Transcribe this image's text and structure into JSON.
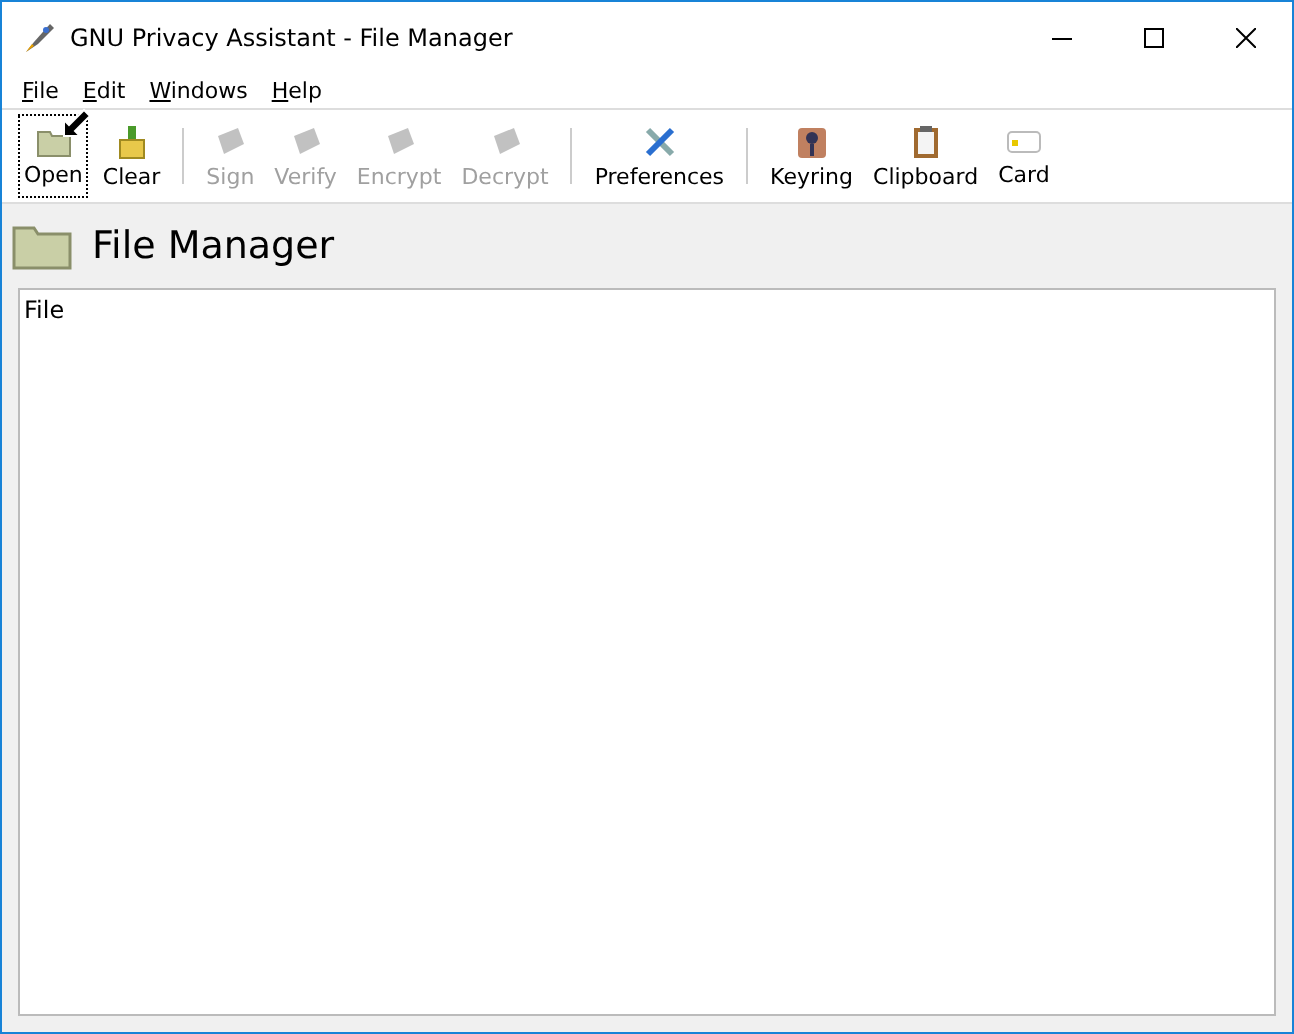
{
  "window": {
    "title": "GNU Privacy Assistant - File Manager"
  },
  "menu": [
    {
      "label": "File"
    },
    {
      "label": "Edit"
    },
    {
      "label": "Windows"
    },
    {
      "label": "Help"
    }
  ],
  "toolbar": [
    {
      "kind": "button",
      "label": "Open",
      "disabled": false,
      "focused": true
    },
    {
      "kind": "button",
      "label": "Clear",
      "disabled": false,
      "focused": false
    },
    {
      "kind": "separator"
    },
    {
      "kind": "button",
      "label": "Sign",
      "disabled": true,
      "focused": false
    },
    {
      "kind": "button",
      "label": "Verify",
      "disabled": true,
      "focused": false
    },
    {
      "kind": "button",
      "label": "Encrypt",
      "disabled": true,
      "focused": false
    },
    {
      "kind": "button",
      "label": "Decrypt",
      "disabled": true,
      "focused": false
    },
    {
      "kind": "separator"
    },
    {
      "kind": "button",
      "label": "Preferences",
      "disabled": false,
      "focused": false
    },
    {
      "kind": "separator"
    },
    {
      "kind": "button",
      "label": "Keyring",
      "disabled": false,
      "focused": false
    },
    {
      "kind": "button",
      "label": "Clipboard",
      "disabled": false,
      "focused": false
    },
    {
      "kind": "button",
      "label": "Card",
      "disabled": false,
      "focused": false
    }
  ],
  "header": {
    "title": "File Manager"
  },
  "file_list": {
    "columns": [
      "File"
    ]
  }
}
